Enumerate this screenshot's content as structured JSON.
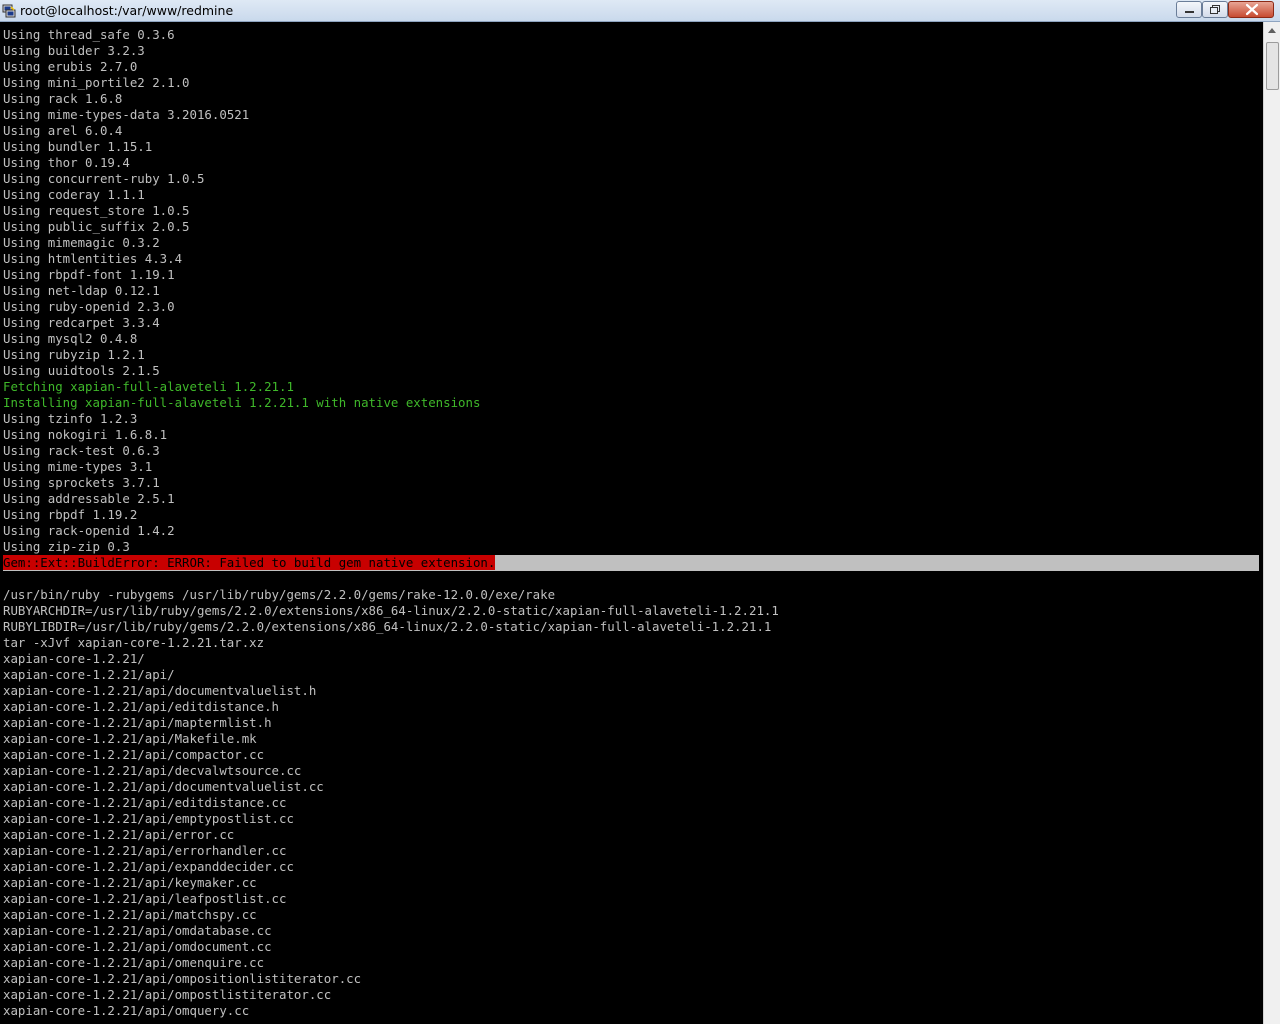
{
  "window": {
    "title": "root@localhost:/var/www/redmine",
    "icon": "putty-terminal-icon",
    "controls": {
      "minimize": "minimize-icon",
      "maximize": "maximize-icon",
      "close": "close-icon"
    }
  },
  "terminal": {
    "colors": {
      "background": "#000000",
      "foreground": "#c0c0c0",
      "highlight": "#3fb82a",
      "error_bg": "#c80000",
      "error_bar": "#c0c0c0"
    },
    "lines": [
      {
        "text": "Using thread_safe 0.3.6",
        "style": "normal"
      },
      {
        "text": "Using builder 3.2.3",
        "style": "normal"
      },
      {
        "text": "Using erubis 2.7.0",
        "style": "normal"
      },
      {
        "text": "Using mini_portile2 2.1.0",
        "style": "normal"
      },
      {
        "text": "Using rack 1.6.8",
        "style": "normal"
      },
      {
        "text": "Using mime-types-data 3.2016.0521",
        "style": "normal"
      },
      {
        "text": "Using arel 6.0.4",
        "style": "normal"
      },
      {
        "text": "Using bundler 1.15.1",
        "style": "normal"
      },
      {
        "text": "Using thor 0.19.4",
        "style": "normal"
      },
      {
        "text": "Using concurrent-ruby 1.0.5",
        "style": "normal"
      },
      {
        "text": "Using coderay 1.1.1",
        "style": "normal"
      },
      {
        "text": "Using request_store 1.0.5",
        "style": "normal"
      },
      {
        "text": "Using public_suffix 2.0.5",
        "style": "normal"
      },
      {
        "text": "Using mimemagic 0.3.2",
        "style": "normal"
      },
      {
        "text": "Using htmlentities 4.3.4",
        "style": "normal"
      },
      {
        "text": "Using rbpdf-font 1.19.1",
        "style": "normal"
      },
      {
        "text": "Using net-ldap 0.12.1",
        "style": "normal"
      },
      {
        "text": "Using ruby-openid 2.3.0",
        "style": "normal"
      },
      {
        "text": "Using redcarpet 3.3.4",
        "style": "normal"
      },
      {
        "text": "Using mysql2 0.4.8",
        "style": "normal"
      },
      {
        "text": "Using rubyzip 1.2.1",
        "style": "normal"
      },
      {
        "text": "Using uuidtools 2.1.5",
        "style": "normal"
      },
      {
        "text": "Fetching xapian-full-alaveteli 1.2.21.1",
        "style": "green"
      },
      {
        "text": "Installing xapian-full-alaveteli 1.2.21.1 with native extensions",
        "style": "green"
      },
      {
        "text": "Using tzinfo 1.2.3",
        "style": "normal"
      },
      {
        "text": "Using nokogiri 1.6.8.1",
        "style": "normal"
      },
      {
        "text": "Using rack-test 0.6.3",
        "style": "normal"
      },
      {
        "text": "Using mime-types 3.1",
        "style": "normal"
      },
      {
        "text": "Using sprockets 3.7.1",
        "style": "normal"
      },
      {
        "text": "Using addressable 2.5.1",
        "style": "normal"
      },
      {
        "text": "Using rbpdf 1.19.2",
        "style": "normal"
      },
      {
        "text": "Using rack-openid 1.4.2",
        "style": "normal"
      },
      {
        "text": "Using zip-zip 0.3",
        "style": "normal"
      },
      {
        "text": "Gem::Ext::BuildError: ERROR: Failed to build gem native extension.",
        "style": "error"
      },
      {
        "text": "",
        "style": "normal"
      },
      {
        "text": "/usr/bin/ruby -rubygems /usr/lib/ruby/gems/2.2.0/gems/rake-12.0.0/exe/rake",
        "style": "normal"
      },
      {
        "text": "RUBYARCHDIR=/usr/lib/ruby/gems/2.2.0/extensions/x86_64-linux/2.2.0-static/xapian-full-alaveteli-1.2.21.1",
        "style": "normal"
      },
      {
        "text": "RUBYLIBDIR=/usr/lib/ruby/gems/2.2.0/extensions/x86_64-linux/2.2.0-static/xapian-full-alaveteli-1.2.21.1",
        "style": "normal"
      },
      {
        "text": "tar -xJvf xapian-core-1.2.21.tar.xz",
        "style": "normal"
      },
      {
        "text": "xapian-core-1.2.21/",
        "style": "normal"
      },
      {
        "text": "xapian-core-1.2.21/api/",
        "style": "normal"
      },
      {
        "text": "xapian-core-1.2.21/api/documentvaluelist.h",
        "style": "normal"
      },
      {
        "text": "xapian-core-1.2.21/api/editdistance.h",
        "style": "normal"
      },
      {
        "text": "xapian-core-1.2.21/api/maptermlist.h",
        "style": "normal"
      },
      {
        "text": "xapian-core-1.2.21/api/Makefile.mk",
        "style": "normal"
      },
      {
        "text": "xapian-core-1.2.21/api/compactor.cc",
        "style": "normal"
      },
      {
        "text": "xapian-core-1.2.21/api/decvalwtsource.cc",
        "style": "normal"
      },
      {
        "text": "xapian-core-1.2.21/api/documentvaluelist.cc",
        "style": "normal"
      },
      {
        "text": "xapian-core-1.2.21/api/editdistance.cc",
        "style": "normal"
      },
      {
        "text": "xapian-core-1.2.21/api/emptypostlist.cc",
        "style": "normal"
      },
      {
        "text": "xapian-core-1.2.21/api/error.cc",
        "style": "normal"
      },
      {
        "text": "xapian-core-1.2.21/api/errorhandler.cc",
        "style": "normal"
      },
      {
        "text": "xapian-core-1.2.21/api/expanddecider.cc",
        "style": "normal"
      },
      {
        "text": "xapian-core-1.2.21/api/keymaker.cc",
        "style": "normal"
      },
      {
        "text": "xapian-core-1.2.21/api/leafpostlist.cc",
        "style": "normal"
      },
      {
        "text": "xapian-core-1.2.21/api/matchspy.cc",
        "style": "normal"
      },
      {
        "text": "xapian-core-1.2.21/api/omdatabase.cc",
        "style": "normal"
      },
      {
        "text": "xapian-core-1.2.21/api/omdocument.cc",
        "style": "normal"
      },
      {
        "text": "xapian-core-1.2.21/api/omenquire.cc",
        "style": "normal"
      },
      {
        "text": "xapian-core-1.2.21/api/ompositionlistiterator.cc",
        "style": "normal"
      },
      {
        "text": "xapian-core-1.2.21/api/ompostlistiterator.cc",
        "style": "normal"
      },
      {
        "text": "xapian-core-1.2.21/api/omquery.cc",
        "style": "normal"
      }
    ]
  },
  "scrollbar": {
    "up_icon": "scroll-up-arrow-icon"
  }
}
